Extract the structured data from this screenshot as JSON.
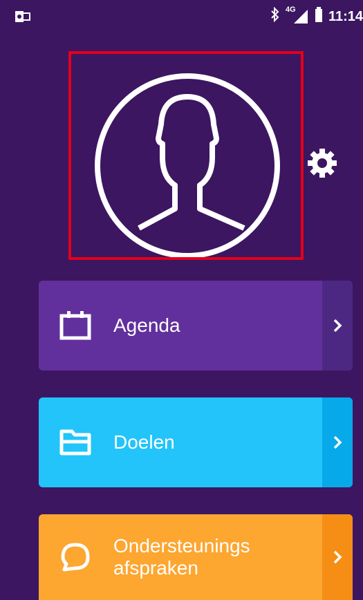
{
  "status_bar": {
    "left_icon": "outlook-notification-icon",
    "right_icons": [
      "bluetooth-icon",
      "4g-signal-icon",
      "battery-icon"
    ],
    "network_label": "4G",
    "time": "11:14"
  },
  "profile": {
    "avatar_icon": "user-silhouette-icon",
    "settings_icon": "gear-icon"
  },
  "menu": [
    {
      "label": "Agenda",
      "icon": "calendar-icon",
      "color": "#62309c"
    },
    {
      "label": "Doelen",
      "icon": "folder-icon",
      "color": "#22c4fa"
    },
    {
      "label": "Ondersteunings\nafspraken",
      "label_line1": "Ondersteunings",
      "label_line2": "afspraken",
      "icon": "chat-bubble-icon",
      "color": "#fda630"
    }
  ],
  "colors": {
    "background": "#3c1661",
    "highlight_border": "#e4001b"
  }
}
